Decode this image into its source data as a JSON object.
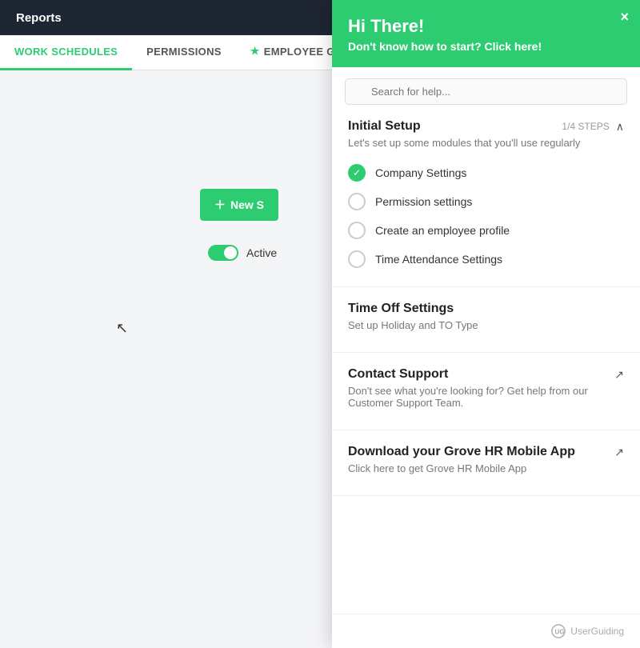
{
  "header": {
    "title": "Reports"
  },
  "tabs": [
    {
      "label": "WORK SCHEDULES",
      "active": true,
      "has_star": false
    },
    {
      "label": "PERMISSIONS",
      "active": false,
      "has_star": false
    },
    {
      "label": "EMPLOYEE GROUPS",
      "active": false,
      "has_star": true
    }
  ],
  "toolbar": {
    "new_button_label": "+ New S...",
    "active_toggle_label": "Active"
  },
  "panel": {
    "greeting": "Hi There!",
    "subtitle": "Don't know how to start? Click here!",
    "close_label": "×",
    "search_placeholder": "Search for help...",
    "sections": [
      {
        "id": "initial-setup",
        "title": "Initial Setup",
        "description": "Let's set up some modules that you'll use regularly",
        "steps": "1/4 STEPS",
        "collapsed": false,
        "items": [
          {
            "label": "Company Settings",
            "done": true
          },
          {
            "label": "Permission settings",
            "done": false
          },
          {
            "label": "Create an employee profile",
            "done": false
          },
          {
            "label": "Time Attendance Settings",
            "done": false
          }
        ]
      },
      {
        "id": "time-off",
        "title": "Time Off Settings",
        "description": "Set up Holiday and TO Type",
        "has_link": false
      },
      {
        "id": "contact-support",
        "title": "Contact Support",
        "description": "Don't see what you're looking for? Get help from our Customer Support Team.",
        "has_link": true
      },
      {
        "id": "mobile-app",
        "title": "Download your Grove HR Mobile App",
        "description": "Click here to get Grove HR Mobile App",
        "has_link": true
      }
    ],
    "footer": {
      "powered_by": "UserGuiding"
    }
  }
}
